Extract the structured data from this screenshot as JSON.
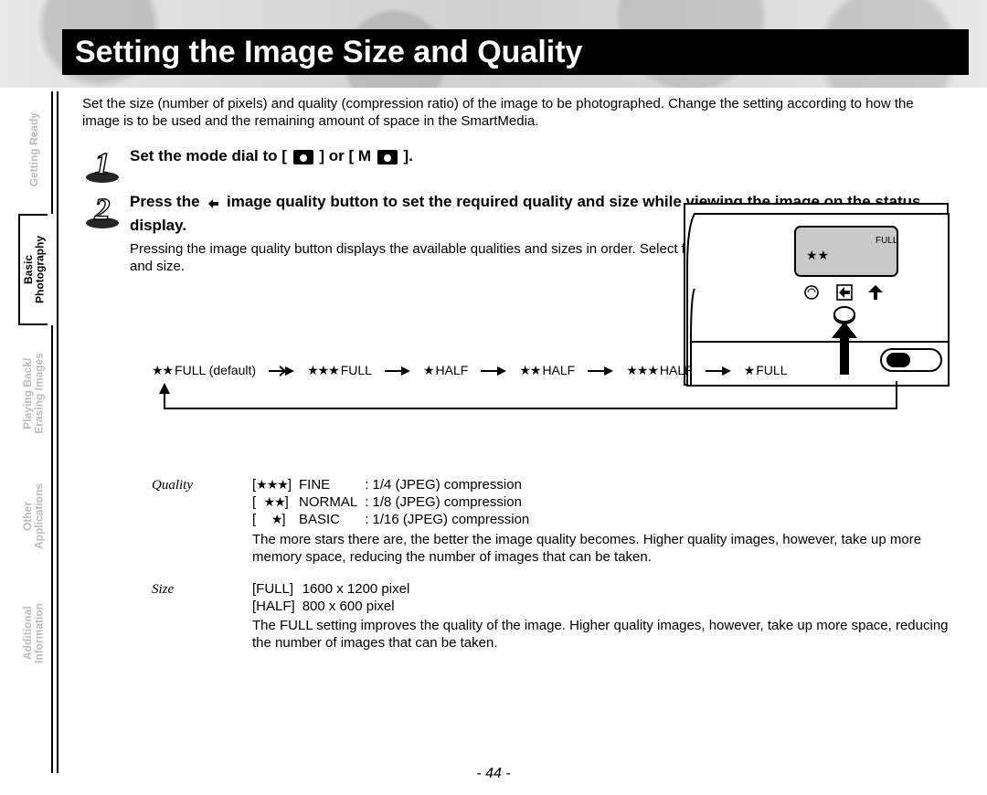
{
  "title": "Setting the Image Size and Quality",
  "page_number": "- 44 -",
  "tabs": [
    {
      "label": "Getting Ready",
      "active": false
    },
    {
      "label": "Basic\nPhotography",
      "active": true
    },
    {
      "label": "Playing Back/\nErasing Images",
      "active": false
    },
    {
      "label": "Other\nApplications",
      "active": false
    },
    {
      "label": "Additional\nInformation",
      "active": false
    }
  ],
  "intro": "Set the size (number of pixels) and quality (compression ratio) of the image to be photographed.\nChange the setting according to how the image is to be used and the remaining amount of space in the SmartMedia.",
  "step1": {
    "prefix": "Set the mode dial to [",
    "mid": "] or [",
    "m": "M",
    "suffix": "]."
  },
  "step2": {
    "head_a": "Press the ",
    "head_b": " image quality button to set the required quality and size while viewing the image on the status display.",
    "sub": "Pressing the image quality button displays the available qualities and sizes in order. Select from the available combinations of quality and size."
  },
  "illus": {
    "lcd_label": "FULL",
    "lcd_stars": "★★"
  },
  "cycle": [
    {
      "stars": "★★",
      "label": "FULL (default)"
    },
    {
      "stars": "★★★",
      "label": "FULL"
    },
    {
      "stars": "★",
      "label": "HALF"
    },
    {
      "stars": "★★",
      "label": "HALF"
    },
    {
      "stars": "★★★",
      "label": "HALF"
    },
    {
      "stars": "★",
      "label": "FULL"
    }
  ],
  "quality": {
    "tag": "Quality",
    "rows": [
      {
        "stars": "★★★",
        "name": "FINE",
        "desc": ": 1/4 (JPEG) compression"
      },
      {
        "stars": "★★",
        "name": "NORMAL",
        "desc": ": 1/8 (JPEG) compression"
      },
      {
        "stars": "★",
        "name": "BASIC",
        "desc": ": 1/16 (JPEG) compression"
      }
    ],
    "note": "The more stars there are, the better the image quality becomes. Higher quality images, however, take up more memory space, reducing the number of images that can be taken."
  },
  "size": {
    "tag": "Size",
    "rows": [
      {
        "name": "[FULL]",
        "desc": "1600 x 1200 pixel"
      },
      {
        "name": "[HALF]",
        "desc": "800 x 600 pixel"
      }
    ],
    "note": "The FULL setting improves the quality of the image. Higher quality images, however, take up more space, reducing the number of images that can be taken."
  }
}
